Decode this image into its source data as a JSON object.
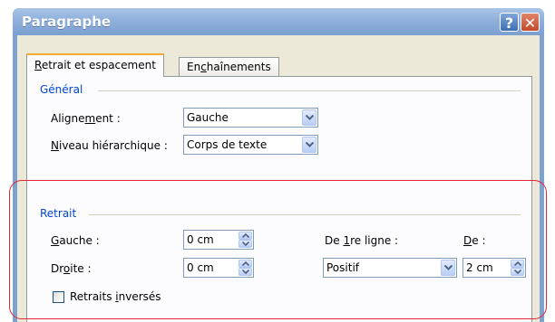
{
  "window": {
    "title": "Paragraphe",
    "help_glyph": "?",
    "close_glyph": "✕"
  },
  "tabs": [
    {
      "label_pre": "",
      "label_u": "R",
      "label_post": "etrait et espacement"
    },
    {
      "label_pre": "En",
      "label_u": "c",
      "label_post": "haînements"
    }
  ],
  "general": {
    "heading": "Général",
    "alignment": {
      "label_pre": "Aligne",
      "label_u": "m",
      "label_post": "ent :",
      "value": "Gauche"
    },
    "level": {
      "label_pre": "",
      "label_u": "N",
      "label_post": "iveau hiérarchique :",
      "value": "Corps de texte"
    }
  },
  "retrait": {
    "heading": "Retrait",
    "left": {
      "label_pre": "",
      "label_u": "G",
      "label_post": "auche :",
      "value": "0 cm"
    },
    "right": {
      "label_pre": "Dr",
      "label_u": "o",
      "label_post": "ite :",
      "value": "0 cm"
    },
    "first_line": {
      "label_pre": "De ",
      "label_u": "1",
      "label_post": "re ligne :",
      "value": "Positif"
    },
    "de": {
      "label_pre": "",
      "label_u": "D",
      "label_post": "e :",
      "value": "2 cm"
    },
    "mirror": {
      "label_pre": "Retraits ",
      "label_u": "i",
      "label_post": "nversés"
    }
  },
  "colors": {
    "accent_highlight": "#e32636",
    "group_heading": "#0046d5",
    "title_bar": "#8fb0db"
  }
}
